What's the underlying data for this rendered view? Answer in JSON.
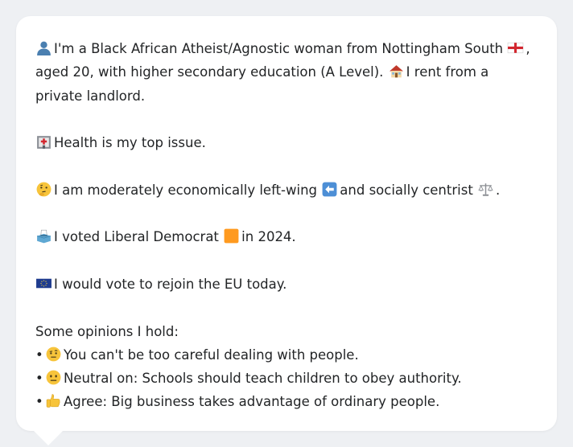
{
  "bio": {
    "line_part1": "I'm a Black African Atheist/Agnostic woman from Nottingham South",
    "line_part2": ", aged 20, with higher secondary education (A Level).",
    "line_part3": "I rent from a private landlord."
  },
  "health": {
    "text": "Health is my top issue."
  },
  "economics": {
    "part1": "I am moderately economically left-wing",
    "part2": "and socially centrist",
    "part3": "."
  },
  "vote": {
    "part1": "I voted Liberal Democrat",
    "part2": "in 2024."
  },
  "eu": {
    "text": "I would vote to rejoin the EU today."
  },
  "opinions": {
    "heading": "Some opinions I hold:",
    "items": [
      {
        "bullet": "•",
        "text": "You can't be too careful dealing with people."
      },
      {
        "bullet": "•",
        "text": "Neutral on: Schools should teach children to obey authority."
      },
      {
        "bullet": "•",
        "text": "Agree: Big business takes advantage of ordinary people."
      }
    ]
  },
  "icons": {
    "person": "bust-in-silhouette-icon",
    "england_flag": "england-flag-icon",
    "house": "house-icon",
    "hospital": "hospital-icon",
    "thinking": "thinking-face-icon",
    "left_arrow": "left-arrow-icon",
    "scales": "balance-scale-icon",
    "ballot": "ballot-box-icon",
    "orange_square": "orange-square-icon",
    "eu_flag": "eu-flag-icon",
    "raised_eyebrow": "raised-eyebrow-face-icon",
    "neutral_face": "neutral-face-icon",
    "thumbs_up": "thumbs-up-icon"
  },
  "colors": {
    "bubble_background": "#ffffff",
    "page_background": "#eef0f3",
    "text": "#222426",
    "lib_dem_orange": "#ff9a1f"
  }
}
